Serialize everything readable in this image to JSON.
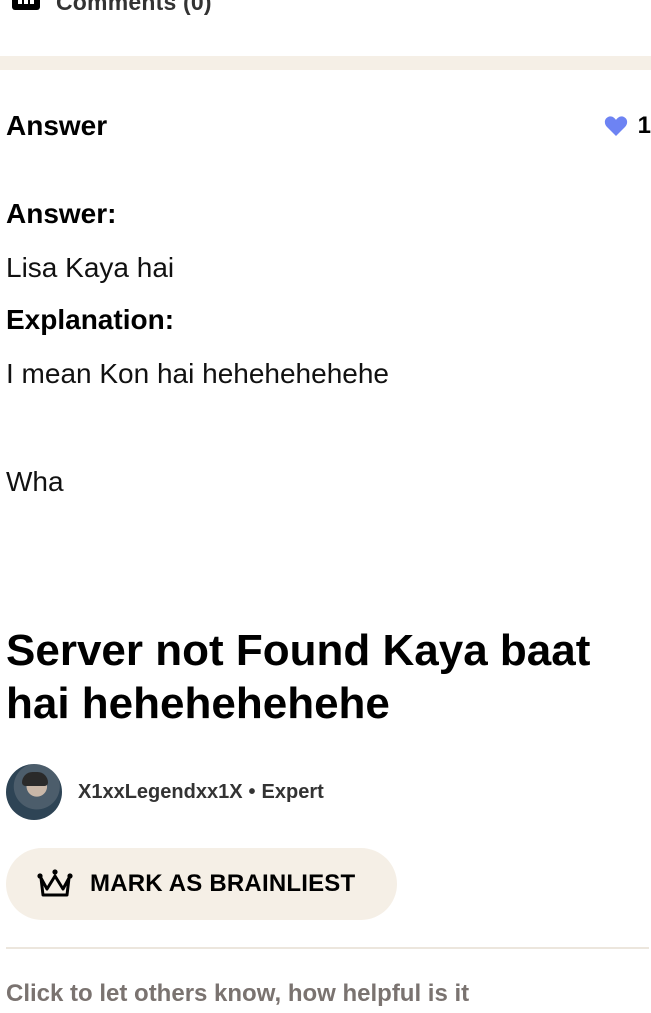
{
  "comments": {
    "label": "Comments (0)",
    "icon": "comment-icon"
  },
  "answer": {
    "heading": "Answer",
    "likes": {
      "count": "1",
      "icon": "heart-icon",
      "color": "#6d83f3"
    },
    "answer_label": "Answer:",
    "answer_text": "Lisa Kaya hai",
    "explanation_label": "Explanation:",
    "explanation_text": "I mean Kon hai hehehehehehe",
    "extra_text": "Wha",
    "big_title": "Server not Found Kaya baat hai hehehehehehe"
  },
  "author": {
    "name": "X1xxLegendxx1X",
    "separator": "•",
    "rank": "Expert",
    "avatar_icon": "avatar"
  },
  "actions": {
    "brainliest_label": "MARK AS BRAINLIEST",
    "brainliest_icon": "crown-icon",
    "brainliest_bg": "#f5efe6"
  },
  "footer": {
    "helpful_text": "Click to let others know, how helpful is it"
  }
}
